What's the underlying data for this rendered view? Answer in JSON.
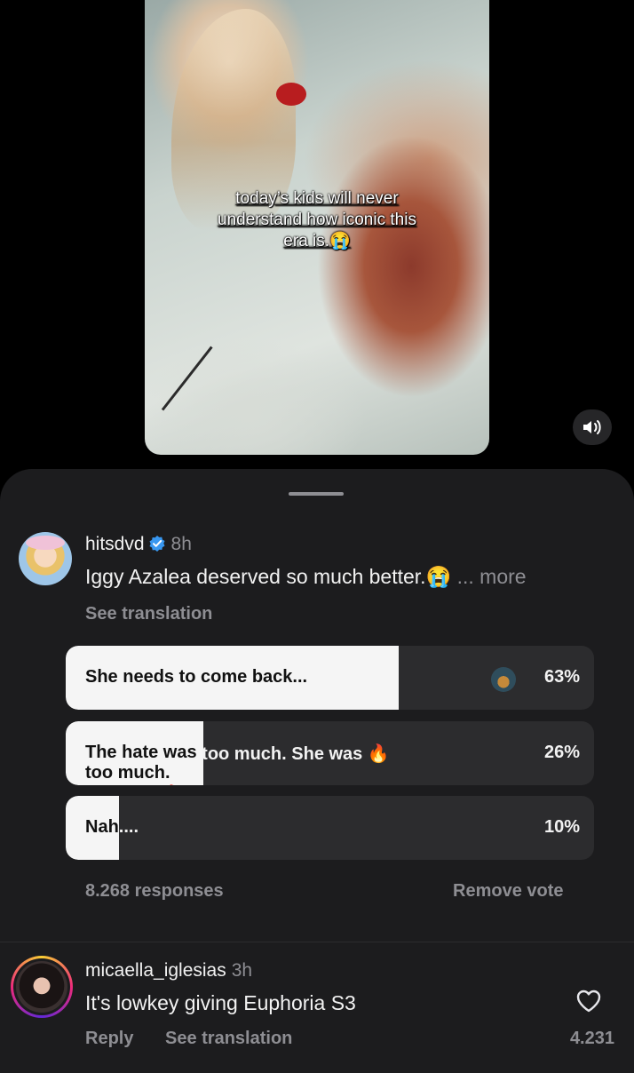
{
  "video": {
    "caption_lines": [
      "today’s kids will never",
      "understand how iconic this",
      "era is.😭"
    ],
    "sound_icon": "speaker-icon"
  },
  "post": {
    "username": "hitsdvd",
    "verified": true,
    "time": "8h",
    "text": "Iggy Azalea deserved so much better.😭",
    "more_label": "... more",
    "see_translation": "See translation"
  },
  "poll": {
    "options": [
      {
        "label": "She needs to come back...",
        "percent_label": "63%",
        "percent": 63,
        "selected": true
      },
      {
        "label": "The hate was too much. She was 🔥",
        "percent_label": "26%",
        "percent": 26
      },
      {
        "label": "Nah....",
        "percent_label": "10%",
        "percent": 10
      }
    ],
    "responses": "8.268 responses",
    "remove_vote": "Remove vote"
  },
  "reply": {
    "username": "micaella_iglesias",
    "time": "3h",
    "text": "It's lowkey giving Euphoria S3",
    "reply_label": "Reply",
    "see_translation": "See translation",
    "likes": "4.231"
  },
  "colors": {
    "sheet": "#1c1c1e",
    "option_bg": "#2c2c2e",
    "fill": "#f5f5f5",
    "verified": "#3897f0"
  }
}
